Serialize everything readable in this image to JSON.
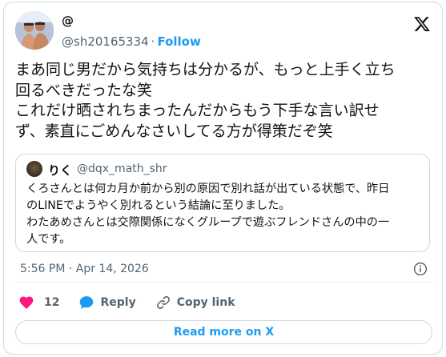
{
  "author": {
    "display_name": "@",
    "handle": "@sh20165334",
    "separator": "·",
    "follow_label": "Follow"
  },
  "tweet": {
    "text": "まあ同じ男だから気持ちは分かるが、もっと上手く立ち\n回るべきだったな笑\nこれだけ晒されちまったんだからもう下手な言い訳せ\nず、素直にごめんなさいしてる方が得策だぞ笑"
  },
  "quote": {
    "name": "りく",
    "handle": "@dqx_math_shr",
    "text": "くろさんとは何カ月か前から別の原因で別れ話が出ている状態で、昨日\nのLINEでようやく別れるという結論に至りました。\nわたあめさんとは交際関係になくグループで遊ぶフレンドさんの中の一\n人です。"
  },
  "timestamp": "5:56 PM · Apr 14, 2026",
  "actions": {
    "like_count": "12",
    "reply_label": "Reply",
    "copy_link_label": "Copy link"
  },
  "read_more_label": "Read more on X",
  "colors": {
    "accent": "#1d9bf0",
    "like": "#f91880",
    "text": "#0f1419",
    "muted": "#536471",
    "border": "#cfd9de"
  },
  "icons": [
    "x-logo-icon",
    "info-icon",
    "heart-icon",
    "reply-bubble-icon",
    "link-icon"
  ]
}
